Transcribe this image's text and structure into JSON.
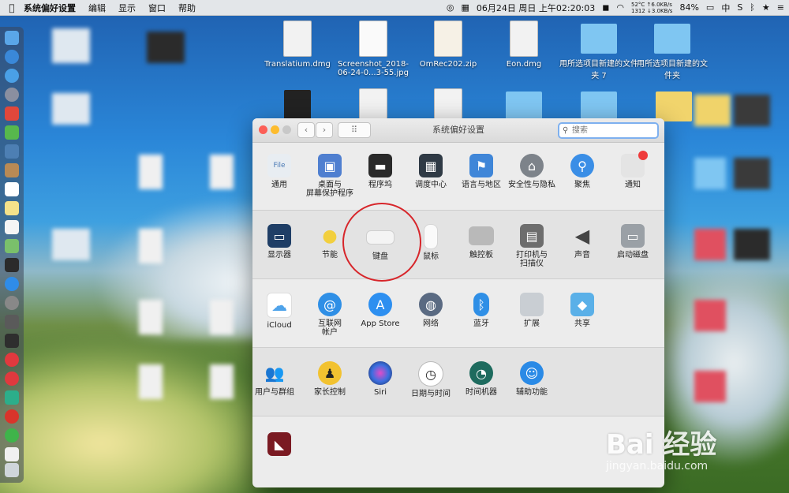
{
  "menubar": {
    "app_name": "系统偏好设置",
    "items": [
      "编辑",
      "显示",
      "窗口",
      "帮助"
    ],
    "date_time": "06月24日 周日 上午02:20:03",
    "net_up": "52°C  ↑6.0KB/s",
    "net_down": "1312  ↓3.0KB/s",
    "battery": "84%",
    "input_method": "中"
  },
  "desktop": {
    "files": [
      {
        "name": "Translatium.dmg",
        "kind": "doc"
      },
      {
        "name": "Screenshot_2018-06-24-0...3-55.jpg",
        "kind": "img"
      },
      {
        "name": "OmRec202.zip",
        "kind": "zip"
      },
      {
        "name": "Eon.dmg",
        "kind": "doc"
      },
      {
        "name": "用所选项目新建的文件夹 7",
        "kind": "folder"
      },
      {
        "name": "用所选项目新建的文件夹",
        "kind": "folder"
      }
    ]
  },
  "window": {
    "title": "系统偏好设置",
    "search_placeholder": "搜索",
    "rows": [
      [
        "通用",
        "桌面与\n屏幕保护程序",
        "程序坞",
        "调度中心",
        "语言与地区",
        "安全性与隐私",
        "聚焦",
        "通知"
      ],
      [
        "显示器",
        "节能",
        "键盘",
        "鼠标",
        "触控板",
        "打印机与\n扫描仪",
        "声音",
        "启动磁盘"
      ],
      [
        "iCloud",
        "互联网\n帐户",
        "App Store",
        "网络",
        "蓝牙",
        "扩展",
        "共享"
      ],
      [
        "用户与群组",
        "家长控制",
        "Siri",
        "日期与时间",
        "时间机器",
        "辅助功能"
      ],
      [
        ""
      ]
    ]
  },
  "watermark": {
    "brand": "Bai 经验",
    "url": "jingyan.baidu.com"
  },
  "colors": {
    "highlight_circle": "#d7262b",
    "accent": "#7eb0ef"
  }
}
